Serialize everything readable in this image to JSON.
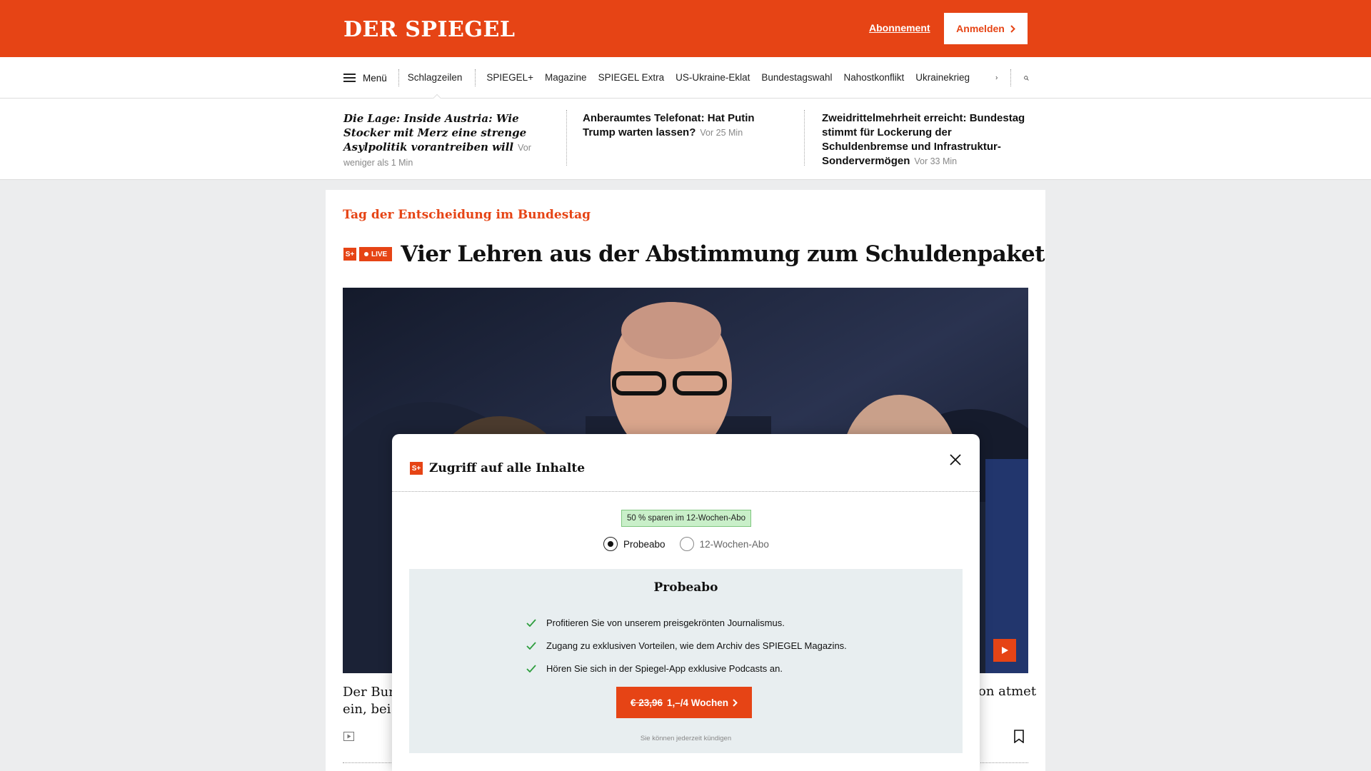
{
  "header": {
    "logo": "DER SPIEGEL",
    "abo_link": "Abonnement",
    "login_label": "Anmelden",
    "brand_color": "#e64415"
  },
  "nav": {
    "menu_label": "Menü",
    "items": [
      "Schlagzeilen",
      "SPIEGEL+",
      "Magazine",
      "SPIEGEL Extra",
      "US-Ukraine-Eklat",
      "Bundestagswahl",
      "Nahostkonflikt",
      "Ukrainekrieg"
    ],
    "active_item": "Schlagzeilen"
  },
  "teasers": [
    {
      "title": "Die Lage: Inside Austria: Wie Stocker mit Merz eine strenge Asylpolitik vorantreiben will",
      "time": "Vor weniger als 1 Min"
    },
    {
      "title": "Anberaumtes Telefonat: Hat Putin Trump warten lassen?",
      "time": "Vor 25 Min"
    },
    {
      "title": "Zweidrittelmehrheit erreicht: Bundestag stimmt für Lockerung der Schuldenbremse und Infrastruktur-Sondervermögen",
      "time": "Vor 33 Min"
    }
  ],
  "article": {
    "kicker": "Tag der Entscheidung im Bundestag",
    "splus_badge": "S+",
    "live_badge": "LIVE",
    "headline": "Vier Lehren aus der Abstimmung zum Schuldenpaket",
    "lead_left_line1": "Der Bun",
    "lead_left_line2": "ein, bei r",
    "lead_right": "on atmet"
  },
  "modal": {
    "title": "Zugriff auf alle Inhalte",
    "save_badge": "50 % sparen im 12-Wochen-Abo",
    "radio_options": [
      "Probeabo",
      "12-Wochen-Abo"
    ],
    "selected_option": "Probeabo",
    "offer_title": "Probeabo",
    "benefits": [
      "Profitieren Sie von unserem preisgekrönten Journalismus.",
      "Zugang zu exklusiven Vorteilen, wie dem Archiv des SPIEGEL Magazins.",
      "Hören Sie sich in der Spiegel-App exklusive Podcasts an."
    ],
    "cta_old_price": "€ 23,96",
    "cta_new_price": "1,–/4 Wochen",
    "cancel_note": "Sie können jederzeit kündigen"
  }
}
